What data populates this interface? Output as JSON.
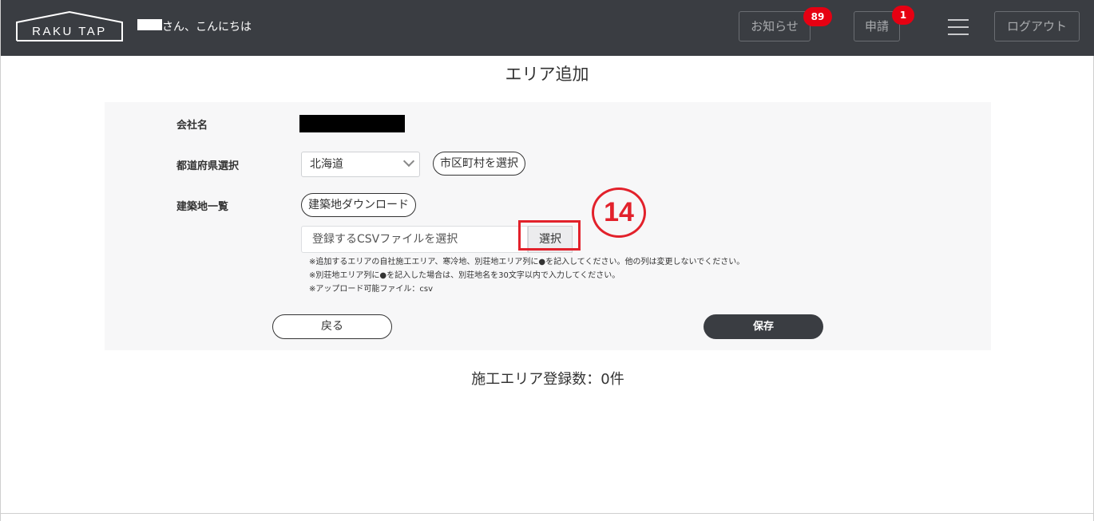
{
  "header": {
    "logo_text": "RAKU TAP",
    "greeting": "さん、こんにちは",
    "notice_label": "お知らせ",
    "notice_count": "89",
    "apply_label": "申請",
    "apply_count": "1",
    "logout_label": "ログアウト"
  },
  "page": {
    "title": "エリア追加"
  },
  "form": {
    "company_label": "会社名",
    "prefecture_label": "都道府県選択",
    "prefecture_value": "北海道",
    "city_button": "市区町村を選択",
    "site_list_label": "建築地一覧",
    "download_button": "建築地ダウンロード",
    "file_placeholder": "登録するCSVファイルを選択",
    "file_select_button": "選択",
    "notes": [
      "※追加するエリアの自社施工エリア、寒冷地、別荘地エリア列に●を記入してください。他の列は変更しないでください。",
      "※別荘地エリア列に●を記入した場合は、別荘地名を30文字以内で入力してください。",
      "※アップロード可能ファイル：csv"
    ],
    "back_button": "戻る",
    "save_button": "保存"
  },
  "annotation": {
    "step_number": "14"
  },
  "summary": {
    "count_text": "施工エリア登録数：0件"
  },
  "colors": {
    "header_bg": "#3a3d42",
    "badge": "#e60012",
    "annotation": "#e2212b",
    "panel_bg": "#f7f7f8"
  }
}
